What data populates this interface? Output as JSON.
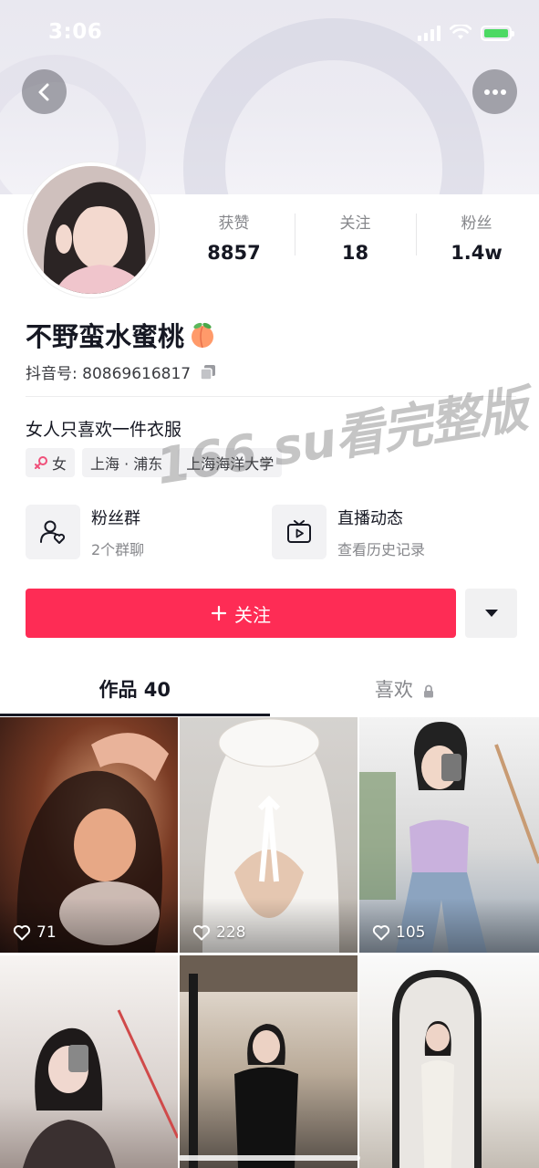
{
  "status_bar": {
    "time": "3:06"
  },
  "profile": {
    "nickname": "不野蛮水蜜桃",
    "nickname_emoji": "peach",
    "douyin_id_label": "抖音号: ",
    "douyin_id": "80869616817",
    "bio": "女人只喜欢一件衣服",
    "stats": [
      {
        "label": "获赞",
        "value": "8857"
      },
      {
        "label": "关注",
        "value": "18"
      },
      {
        "label": "粉丝",
        "value": "1.4w"
      }
    ],
    "tags": [
      {
        "label": "女",
        "icon": "female-icon"
      },
      {
        "label": "上海 · 浦东"
      },
      {
        "label": "上海海洋大学"
      }
    ],
    "features": [
      {
        "title": "粉丝群",
        "sub": "2个群聊",
        "icon": "fans-group-icon"
      },
      {
        "title": "直播动态",
        "sub": "查看历史记录",
        "icon": "live-replay-icon"
      }
    ]
  },
  "actions": {
    "follow_label": "关注",
    "follow_icon": "plus-icon"
  },
  "tabs": [
    {
      "label": "作品 40",
      "active": true
    },
    {
      "label": "喜欢",
      "locked": true,
      "active": false
    }
  ],
  "grid": {
    "items": [
      {
        "likes": "71"
      },
      {
        "likes": "228"
      },
      {
        "likes": "105"
      },
      {
        "likes": ""
      },
      {
        "likes": ""
      },
      {
        "likes": ""
      }
    ]
  },
  "overlay": {
    "watermark": "166.su看完整版"
  },
  "colors": {
    "accent": "#fe2c55",
    "text": "#161823",
    "muted": "#86878b"
  }
}
